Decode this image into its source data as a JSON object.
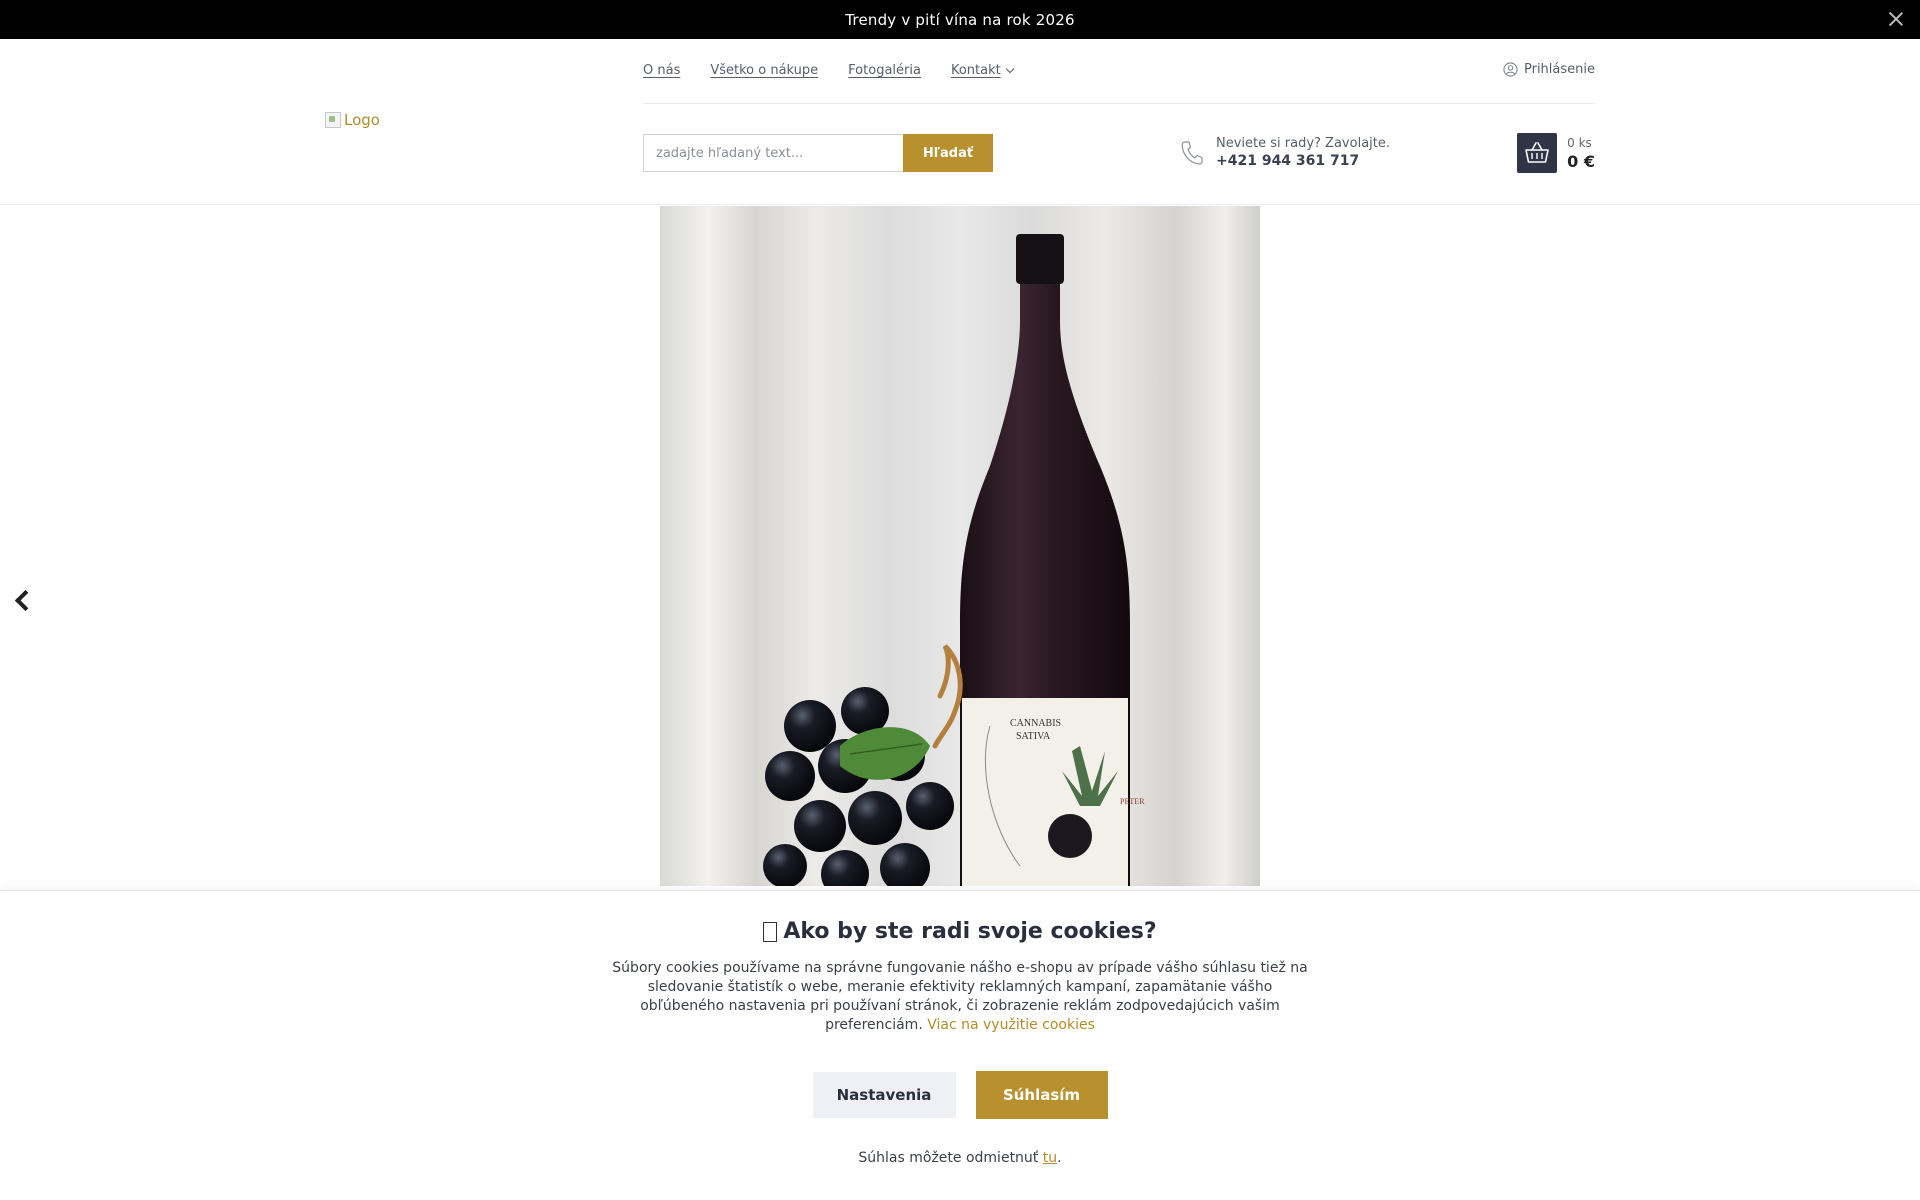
{
  "announcement": {
    "text": "Trendy v pití vína na rok 2026",
    "close_icon": "close-icon"
  },
  "header": {
    "logo_alt": "Logo",
    "nav": [
      {
        "label": "O nás"
      },
      {
        "label": "Všetko o nákupe"
      },
      {
        "label": "Fotogaléria"
      },
      {
        "label": "Kontakt",
        "has_dropdown": true
      }
    ],
    "login_label": "Prihlásenie",
    "search": {
      "placeholder": "zadajte hľadaný text...",
      "button_label": "Hľadať"
    },
    "phone": {
      "prompt": "Neviete si rady? Zavolajte.",
      "number": "+421 944 361 717"
    },
    "cart": {
      "count": "0 ks",
      "price": "0 €"
    }
  },
  "gallery": {
    "prev_icon": "chevron-left-icon",
    "image": {
      "bottle_label_title": "CANNABIS SATIVA",
      "bottle_label_brand": "PETER"
    }
  },
  "cookie_banner": {
    "title": "Ako by ste radi svoje cookies?",
    "text": "Súbory cookies používame na správne fungovanie nášho e-shopu av prípade vášho súhlasu tiež na sledovanie štatistík o webe, meranie efektivity reklamných kampaní, zapamätanie vášho obľúbeného nastavenia pri používaní stránok, či zobrazenie reklám zodpovedajúcich vašim preferenciám.",
    "more_link": "Viac na využitie cookies",
    "settings_label": "Nastavenia",
    "agree_label": "Súhlasím",
    "refuse_text": "Súhlas môžete odmietnuť",
    "refuse_link": "tu",
    "refuse_suffix": "."
  },
  "colors": {
    "accent": "#b8912e",
    "dark": "#2f3447",
    "topbar": "#000000"
  }
}
